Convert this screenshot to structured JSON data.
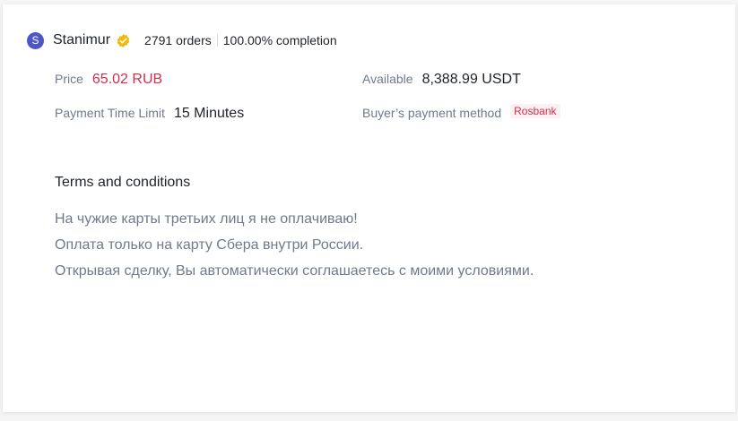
{
  "merchant": {
    "avatar_letter": "S",
    "name": "Stanimur",
    "verified_icon": "verified-badge-icon",
    "orders": "2791 orders",
    "completion": "100.00% completion"
  },
  "details": {
    "price_label": "Price",
    "price_value": "65.02 RUB",
    "available_label": "Available",
    "available_value": "8,388.99 USDT",
    "time_limit_label": "Payment Time Limit",
    "time_limit_value": "15 Minutes",
    "payment_method_label": "Buyer’s payment method",
    "payment_method_value": "Rosbank"
  },
  "terms": {
    "title": "Terms and conditions",
    "lines": [
      "На чужие карты третьих лиц я не оплачиваю!",
      "Оплата только на карту Сбера внутри России.",
      "Открывая сделку, Вы автоматически соглашаетесь с моими условиями."
    ]
  },
  "colors": {
    "accent_red": "#cf304a",
    "avatar_bg": "#4c56c4",
    "verified_gold": "#f0b90b",
    "text_primary": "#1e2329",
    "text_secondary": "#707a8a"
  }
}
